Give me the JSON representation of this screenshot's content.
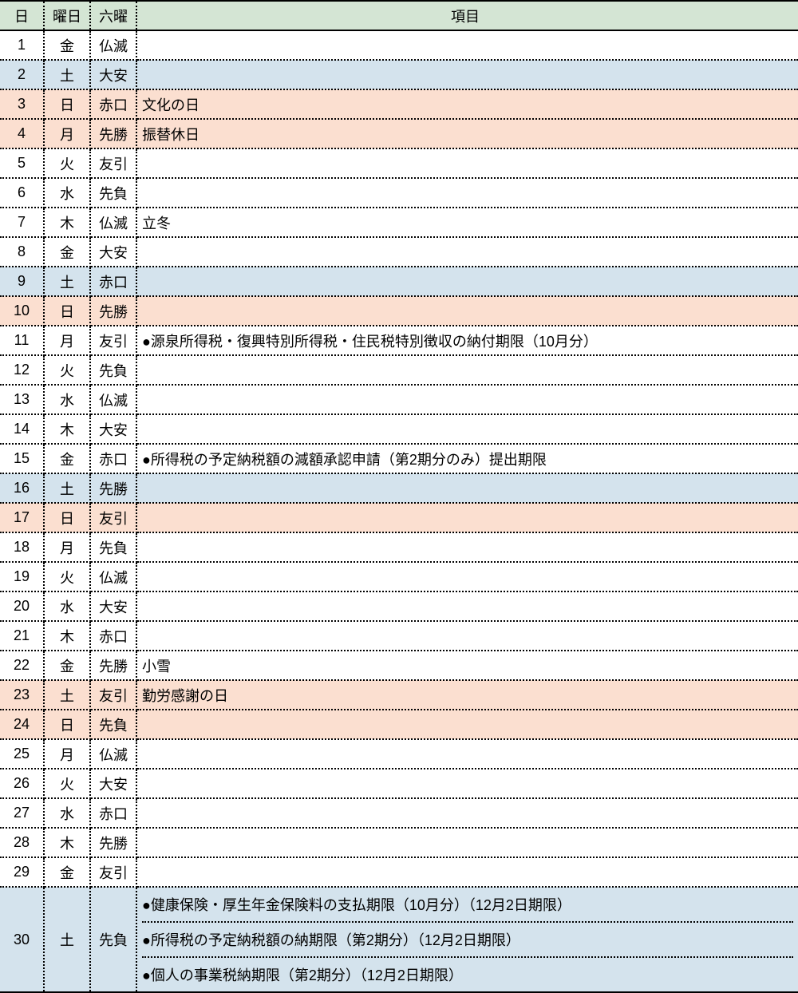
{
  "headers": {
    "day": "日",
    "wday": "曜日",
    "roku": "六曜",
    "item": "項目"
  },
  "rows": [
    {
      "day": "1",
      "wday": "金",
      "roku": "仏滅",
      "items": [],
      "bg": ""
    },
    {
      "day": "2",
      "wday": "土",
      "roku": "大安",
      "items": [],
      "bg": "blue"
    },
    {
      "day": "3",
      "wday": "日",
      "roku": "赤口",
      "items": [
        "文化の日"
      ],
      "bg": "peach"
    },
    {
      "day": "4",
      "wday": "月",
      "roku": "先勝",
      "items": [
        "振替休日"
      ],
      "bg": "peach"
    },
    {
      "day": "5",
      "wday": "火",
      "roku": "友引",
      "items": [],
      "bg": ""
    },
    {
      "day": "6",
      "wday": "水",
      "roku": "先負",
      "items": [],
      "bg": ""
    },
    {
      "day": "7",
      "wday": "木",
      "roku": "仏滅",
      "items": [
        "立冬"
      ],
      "bg": ""
    },
    {
      "day": "8",
      "wday": "金",
      "roku": "大安",
      "items": [],
      "bg": ""
    },
    {
      "day": "9",
      "wday": "土",
      "roku": "赤口",
      "items": [],
      "bg": "blue"
    },
    {
      "day": "10",
      "wday": "日",
      "roku": "先勝",
      "items": [],
      "bg": "peach"
    },
    {
      "day": "11",
      "wday": "月",
      "roku": "友引",
      "items": [
        "●源泉所得税・復興特別所得税・住民税特別徴収の納付期限（10月分）"
      ],
      "bg": ""
    },
    {
      "day": "12",
      "wday": "火",
      "roku": "先負",
      "items": [],
      "bg": ""
    },
    {
      "day": "13",
      "wday": "水",
      "roku": "仏滅",
      "items": [],
      "bg": ""
    },
    {
      "day": "14",
      "wday": "木",
      "roku": "大安",
      "items": [],
      "bg": ""
    },
    {
      "day": "15",
      "wday": "金",
      "roku": "赤口",
      "items": [
        "●所得税の予定納税額の減額承認申請（第2期分のみ）提出期限"
      ],
      "bg": ""
    },
    {
      "day": "16",
      "wday": "土",
      "roku": "先勝",
      "items": [],
      "bg": "blue"
    },
    {
      "day": "17",
      "wday": "日",
      "roku": "友引",
      "items": [],
      "bg": "peach"
    },
    {
      "day": "18",
      "wday": "月",
      "roku": "先負",
      "items": [],
      "bg": ""
    },
    {
      "day": "19",
      "wday": "火",
      "roku": "仏滅",
      "items": [],
      "bg": ""
    },
    {
      "day": "20",
      "wday": "水",
      "roku": "大安",
      "items": [],
      "bg": ""
    },
    {
      "day": "21",
      "wday": "木",
      "roku": "赤口",
      "items": [],
      "bg": ""
    },
    {
      "day": "22",
      "wday": "金",
      "roku": "先勝",
      "items": [
        "小雪"
      ],
      "bg": ""
    },
    {
      "day": "23",
      "wday": "土",
      "roku": "友引",
      "items": [
        "勤労感謝の日"
      ],
      "bg": "peach"
    },
    {
      "day": "24",
      "wday": "日",
      "roku": "先負",
      "items": [],
      "bg": "peach"
    },
    {
      "day": "25",
      "wday": "月",
      "roku": "仏滅",
      "items": [],
      "bg": ""
    },
    {
      "day": "26",
      "wday": "火",
      "roku": "大安",
      "items": [],
      "bg": ""
    },
    {
      "day": "27",
      "wday": "水",
      "roku": "赤口",
      "items": [],
      "bg": ""
    },
    {
      "day": "28",
      "wday": "木",
      "roku": "先勝",
      "items": [],
      "bg": ""
    },
    {
      "day": "29",
      "wday": "金",
      "roku": "友引",
      "items": [],
      "bg": ""
    },
    {
      "day": "30",
      "wday": "土",
      "roku": "先負",
      "items": [
        "●健康保険・厚生年金保険料の支払期限（10月分）（12月2日期限）",
        "●所得税の予定納税額の納期限（第2期分）（12月2日期限）",
        "●個人の事業税納期限（第2期分）（12月2日期限）"
      ],
      "bg": "blue"
    }
  ]
}
